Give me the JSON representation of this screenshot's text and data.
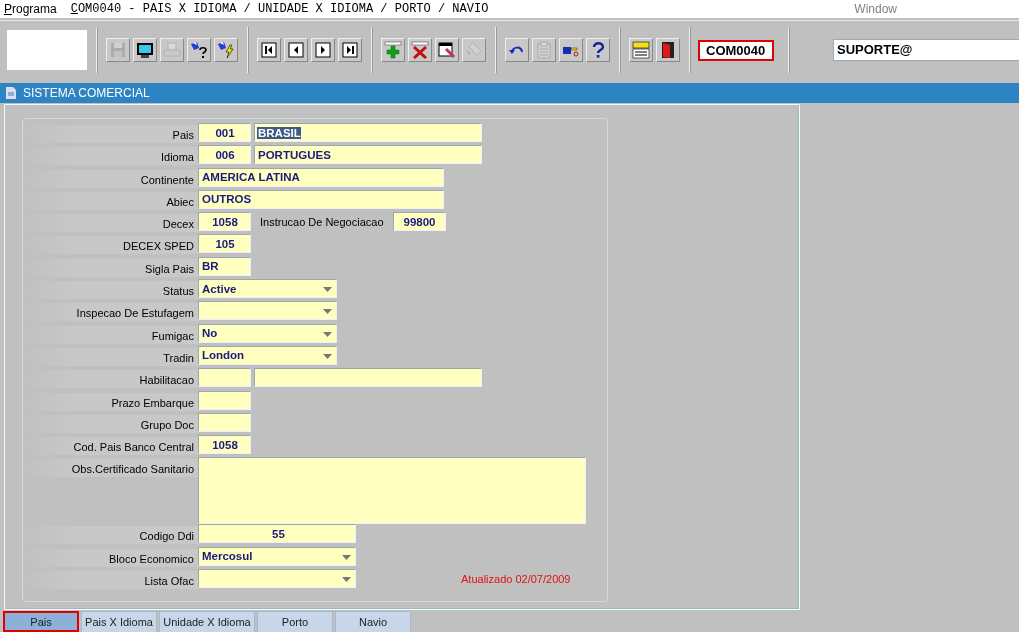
{
  "menu_bar": {
    "items": [
      "Programa",
      "COM0040 - PAIS X IDIOMA / UNIDADE X IDIOMA / PORTO / NAVIO"
    ],
    "window_menu": "Window"
  },
  "toolbar": {
    "groups": [
      [
        {
          "kind": "save",
          "disabled": true
        },
        {
          "kind": "monitor",
          "disabled": false
        },
        {
          "kind": "printer",
          "disabled": true
        },
        {
          "kind": "query",
          "disabled": false
        },
        {
          "kind": "execute",
          "disabled": false
        }
      ],
      [
        {
          "kind": "first",
          "disabled": false
        },
        {
          "kind": "previous",
          "disabled": false
        },
        {
          "kind": "next",
          "disabled": false
        },
        {
          "kind": "last",
          "disabled": false
        }
      ],
      [
        {
          "kind": "insert",
          "disabled": false
        },
        {
          "kind": "delete",
          "disabled": false
        },
        {
          "kind": "edit",
          "disabled": false
        },
        {
          "kind": "eraser",
          "disabled": true
        }
      ],
      [
        {
          "kind": "undo",
          "disabled": false
        },
        {
          "kind": "clipboard",
          "disabled": true
        },
        {
          "kind": "hand",
          "disabled": false
        },
        {
          "kind": "help",
          "disabled": false
        }
      ],
      [
        {
          "kind": "menu",
          "disabled": false
        },
        {
          "kind": "exit",
          "disabled": false
        }
      ]
    ],
    "form_code": "COM0040",
    "user": "SUPORTE@"
  },
  "window": {
    "title": "SISTEMA COMERCIAL"
  },
  "form": {
    "rows": [
      {
        "label": "Pais",
        "fields": [
          {
            "kind": "code",
            "value": "001"
          },
          {
            "kind": "name",
            "value": "BRASIL",
            "highlighted": true
          }
        ]
      },
      {
        "label": "Idioma",
        "fields": [
          {
            "kind": "code",
            "value": "006"
          },
          {
            "kind": "name",
            "value": "PORTUGUES",
            "highlighted": false
          }
        ]
      },
      {
        "label": "Continente",
        "fields": [
          {
            "kind": "wide",
            "value": "AMERICA LATINA"
          }
        ]
      },
      {
        "label": "Abiec",
        "fields": [
          {
            "kind": "wide",
            "value": "OUTROS"
          }
        ]
      },
      {
        "label": "Decex",
        "fields": [
          {
            "kind": "code",
            "value": "1058"
          },
          {
            "kind": "caption",
            "value": "Instrucao De Negociacao"
          },
          {
            "kind": "code",
            "value": "99800"
          }
        ]
      },
      {
        "label": "DECEX SPED",
        "fields": [
          {
            "kind": "code",
            "value": "105"
          }
        ]
      },
      {
        "label": "Sigla Pais",
        "fields": [
          {
            "kind": "short",
            "value": "BR"
          }
        ]
      },
      {
        "label": "Status",
        "fields": [
          {
            "kind": "select",
            "value": "Active"
          }
        ]
      },
      {
        "label": "Inspecao De Estufagem",
        "fields": [
          {
            "kind": "select"
          }
        ]
      },
      {
        "label": "Fumigac",
        "fields": [
          {
            "kind": "select",
            "value": "No"
          }
        ]
      },
      {
        "label": "Tradin",
        "fields": [
          {
            "kind": "select",
            "value": "London"
          }
        ]
      },
      {
        "label": "Habilitacao",
        "fields": [
          {
            "kind": "code"
          },
          {
            "kind": "name"
          }
        ]
      },
      {
        "label": "Prazo Embarque",
        "fields": [
          {
            "kind": "code"
          }
        ]
      },
      {
        "label": "Grupo Doc",
        "fields": [
          {
            "kind": "code"
          }
        ]
      },
      {
        "label": "Cod. Pais Banco Central",
        "fields": [
          {
            "kind": "code",
            "value": "1058"
          }
        ]
      },
      {
        "label": "Obs.Certificado Sanitario",
        "fields": [
          {
            "kind": "textarea"
          }
        ]
      },
      {
        "label": "Codigo Ddi",
        "fields": [
          {
            "kind": "number",
            "value": "55"
          }
        ]
      },
      {
        "label": "Bloco Economico",
        "fields": [
          {
            "kind": "select-wide",
            "value": "Mercosul"
          }
        ]
      },
      {
        "label": "Lista Ofac",
        "fields": [
          {
            "kind": "select-wide"
          },
          {
            "kind": "note",
            "value": "Atualizado 02/07/2009"
          }
        ]
      }
    ]
  },
  "tabs": [
    {
      "label": "Pais",
      "selected": true
    },
    {
      "label": "Pais X Idioma",
      "selected": false
    },
    {
      "label": "Unidade X Idioma",
      "selected": false
    },
    {
      "label": "Porto",
      "selected": false
    },
    {
      "label": "Navio",
      "selected": false
    }
  ]
}
